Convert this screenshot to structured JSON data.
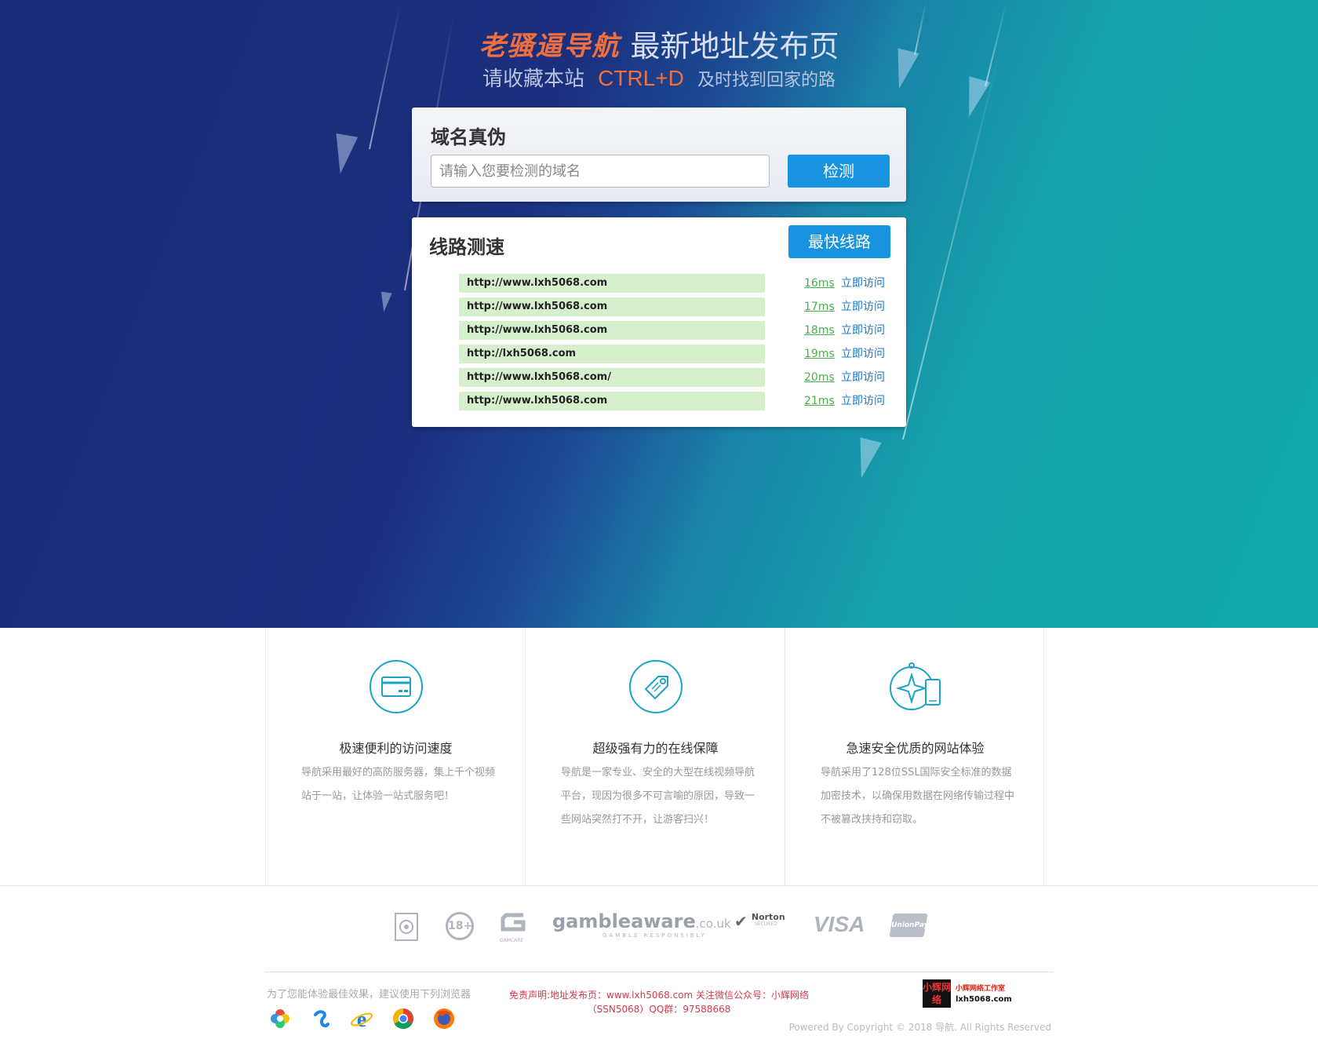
{
  "header": {
    "brand": "老骚逼导航",
    "title": "最新地址发布页",
    "bookmark_prefix": "请收藏本站",
    "bookmark_key": "CTRL+D",
    "bookmark_suffix": "及时找到回家的路"
  },
  "domain_check": {
    "heading": "域名真伪",
    "placeholder": "请输入您要检测的域名",
    "button": "检测"
  },
  "speed_test": {
    "heading": "线路测速",
    "fastest_button": "最快线路",
    "lines": [
      {
        "url": "http://www.lxh5068.com",
        "ms": "16ms",
        "action": "立即访问"
      },
      {
        "url": "http://www.lxh5068.com",
        "ms": "17ms",
        "action": "立即访问"
      },
      {
        "url": "http://www.lxh5068.com",
        "ms": "18ms",
        "action": "立即访问"
      },
      {
        "url": "http://lxh5068.com",
        "ms": "19ms",
        "action": "立即访问"
      },
      {
        "url": "http://www.lxh5068.com/",
        "ms": "20ms",
        "action": "立即访问"
      },
      {
        "url": "http://www.lxh5068.com",
        "ms": "21ms",
        "action": "立即访问"
      }
    ]
  },
  "features": [
    {
      "icon": "credit-card-icon",
      "title": "极速便利的访问速度",
      "text": "导航采用最好的高防服务器，集上千个视频站于一站，让体验一站式服务吧！"
    },
    {
      "icon": "tag-icon",
      "title": "超级强有力的在线保障",
      "text": "导航是一家专业、安全的大型在线视频导航平台，现因为很多不可言喻的原因，导致一些网站突然打不开，让游客扫兴！"
    },
    {
      "icon": "compass-phone-icon",
      "title": "急速安全优质的网站体验",
      "text": "导航采用了128位SSL国际安全标准的数据加密技术，以确保用数据在网络传输过程中不被篡改挟持和窃取。"
    }
  ],
  "trust_logos": {
    "age": "18+",
    "gamcare": "GAMCARE",
    "gambleaware": "gambleaware",
    "gambleaware_suffix": ".co.uk",
    "gambleaware_tagline": "GAMBLE RESPONSIBLY",
    "norton": "Norton",
    "norton_sub": "SECURED",
    "visa": "VISA",
    "unionpay": "UnionPay"
  },
  "footer": {
    "browser_note": "为了您能体验最佳效果，建议使用下列浏览器",
    "disclaimer_line1": "免责声明:地址发布页：www.lxh5068.com 关注微信公众号：小辉网络",
    "disclaimer_line2": "（SSN5068）QQ群：97588668",
    "studio_box": "小辉网络",
    "studio_name": "小辉网络工作室",
    "studio_domain": "lxh5068.com",
    "copyright": "Powered By Copyright © 2018 导航. All Rights Reserved"
  },
  "colors": {
    "accent": "#1793e0",
    "brand": "#ef6f3e",
    "row_bg": "#d6efcd",
    "ms_green": "#4cae4c",
    "link_blue": "#1b76c4"
  }
}
